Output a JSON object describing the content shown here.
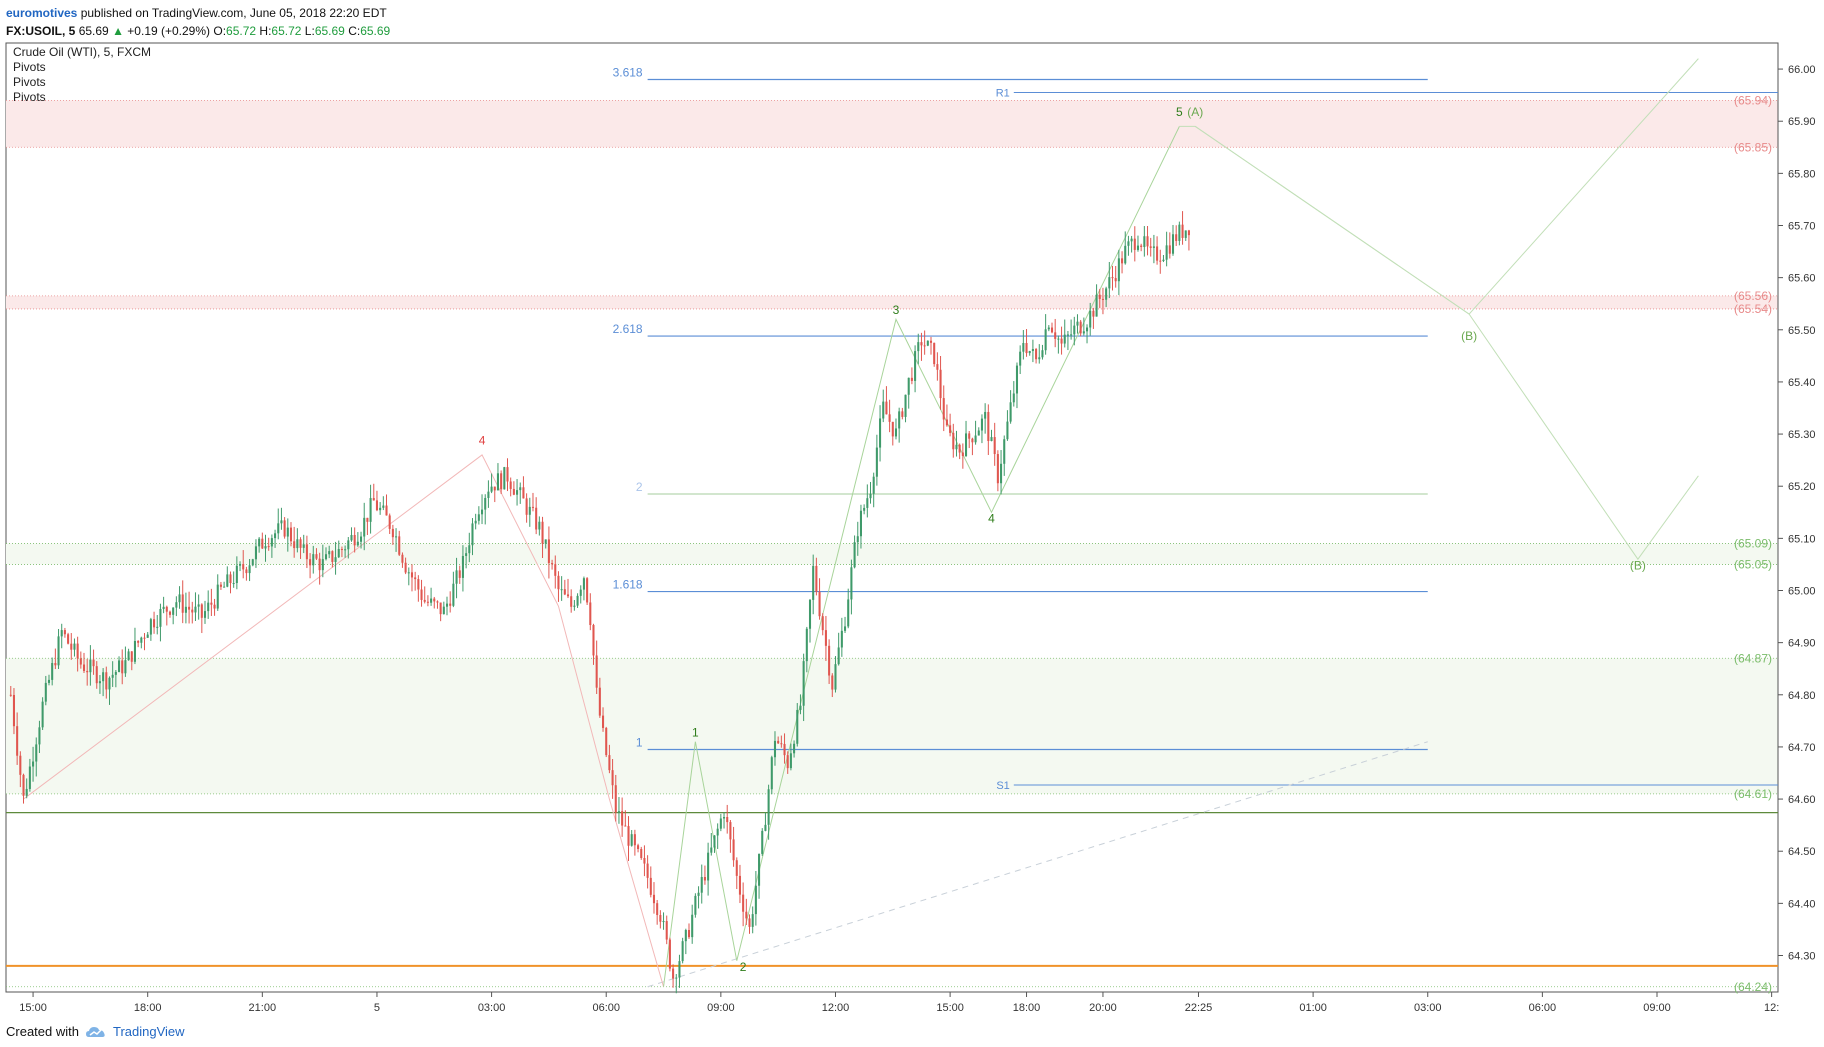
{
  "header": {
    "author": "euromotives",
    "published": "published on TradingView.com, June 05, 2018 22:20 EDT",
    "symbol": "FX:USOIL, 5",
    "last": "65.69",
    "change": "+0.19 (+0.29%)",
    "o_label": "O:",
    "o_value": "65.72",
    "h_label": "H:",
    "h_value": "65.72",
    "l_label": "L:",
    "l_value": "65.69",
    "c_label": "C:",
    "c_value": "65.69"
  },
  "legend": {
    "title": "Crude Oil (WTI), 5, FXCM",
    "indicators": [
      "Pivots",
      "Pivots",
      "Pivots"
    ]
  },
  "footer": {
    "created_with": "Created with",
    "brand": "TradingView"
  },
  "colors": {
    "up": "#3f9a6a",
    "down": "#e0564f",
    "fib": "#5b8ed6",
    "fibLight": "#aac4ea",
    "waveGreen": "#2e7d1a",
    "waveRed": "#e04040",
    "priceRed": "#e88b8b",
    "priceGreen": "#7cbd6c",
    "orange": "#f0922a",
    "axisText": "#333333"
  },
  "chart_data": {
    "type": "candlestick",
    "title": "Crude Oil (WTI), 5, FXCM",
    "ylim": [
      64.23,
      66.05
    ],
    "y_ticks": [
      "64.30",
      "64.40",
      "64.50",
      "64.60",
      "64.70",
      "64.80",
      "64.90",
      "65.00",
      "65.10",
      "65.20",
      "65.30",
      "65.40",
      "65.50",
      "65.60",
      "65.70",
      "65.80",
      "65.90",
      "66.00"
    ],
    "x_ticks": [
      {
        "i": 7,
        "label": "15:00"
      },
      {
        "i": 43,
        "label": "18:00"
      },
      {
        "i": 79,
        "label": "21:00"
      },
      {
        "i": 115,
        "label": "5"
      },
      {
        "i": 151,
        "label": "03:00"
      },
      {
        "i": 187,
        "label": "06:00"
      },
      {
        "i": 223,
        "label": "09:00"
      },
      {
        "i": 259,
        "label": "12:00"
      },
      {
        "i": 295,
        "label": "15:00"
      },
      {
        "i": 319,
        "label": "18:00"
      },
      {
        "i": 343,
        "label": "20:00"
      },
      {
        "i": 373,
        "label": "22:25"
      },
      {
        "i": 409,
        "label": "01:00"
      },
      {
        "i": 445,
        "label": "03:00"
      },
      {
        "i": 481,
        "label": "06:00"
      },
      {
        "i": 517,
        "label": "09:00"
      },
      {
        "i": 553,
        "label": "12:"
      }
    ],
    "x_range": [
      -1.5,
      555
    ],
    "candle_points": [
      [
        0,
        64.8
      ],
      [
        4,
        64.6
      ],
      [
        10,
        64.78
      ],
      [
        16,
        64.92
      ],
      [
        22,
        64.86
      ],
      [
        30,
        64.83
      ],
      [
        36,
        64.86
      ],
      [
        44,
        64.94
      ],
      [
        52,
        64.98
      ],
      [
        60,
        64.95
      ],
      [
        66,
        65.0
      ],
      [
        74,
        65.05
      ],
      [
        80,
        65.1
      ],
      [
        86,
        65.12
      ],
      [
        92,
        65.07
      ],
      [
        98,
        65.05
      ],
      [
        104,
        65.08
      ],
      [
        110,
        65.12
      ],
      [
        114,
        65.17
      ],
      [
        120,
        65.12
      ],
      [
        124,
        65.05
      ],
      [
        130,
        64.98
      ],
      [
        136,
        64.96
      ],
      [
        142,
        65.05
      ],
      [
        146,
        65.15
      ],
      [
        150,
        65.2
      ],
      [
        156,
        65.22
      ],
      [
        160,
        65.18
      ],
      [
        166,
        65.12
      ],
      [
        172,
        65.0
      ],
      [
        176,
        64.97
      ],
      [
        180,
        65.03
      ],
      [
        182,
        64.95
      ],
      [
        184,
        64.8
      ],
      [
        186,
        64.72
      ],
      [
        190,
        64.58
      ],
      [
        196,
        64.5
      ],
      [
        200,
        64.45
      ],
      [
        204,
        64.38
      ],
      [
        208,
        64.26
      ],
      [
        212,
        64.33
      ],
      [
        216,
        64.42
      ],
      [
        220,
        64.5
      ],
      [
        224,
        64.58
      ],
      [
        228,
        64.45
      ],
      [
        232,
        64.35
      ],
      [
        236,
        64.52
      ],
      [
        240,
        64.72
      ],
      [
        244,
        64.67
      ],
      [
        248,
        64.78
      ],
      [
        252,
        65.04
      ],
      [
        258,
        64.82
      ],
      [
        262,
        64.95
      ],
      [
        266,
        65.12
      ],
      [
        270,
        65.2
      ],
      [
        274,
        65.35
      ],
      [
        278,
        65.3
      ],
      [
        282,
        65.4
      ],
      [
        286,
        65.48
      ],
      [
        290,
        65.45
      ],
      [
        294,
        65.3
      ],
      [
        298,
        65.27
      ],
      [
        302,
        65.3
      ],
      [
        306,
        65.33
      ],
      [
        310,
        65.22
      ],
      [
        314,
        65.35
      ],
      [
        318,
        65.48
      ],
      [
        322,
        65.44
      ],
      [
        326,
        65.52
      ],
      [
        330,
        65.47
      ],
      [
        334,
        65.5
      ],
      [
        338,
        65.52
      ],
      [
        342,
        65.56
      ],
      [
        346,
        65.6
      ],
      [
        350,
        65.65
      ],
      [
        354,
        65.68
      ],
      [
        358,
        65.64
      ],
      [
        362,
        65.65
      ],
      [
        366,
        65.68
      ],
      [
        370,
        65.7
      ]
    ],
    "h_levels": [
      {
        "name": "support-line-dark-green",
        "value": 64.574,
        "color": "#5e8a3c",
        "width": 1.3,
        "from": -1.5,
        "to": 555
      },
      {
        "name": "support-line-orange",
        "value": 64.28,
        "color": "#f0922a",
        "width": 2,
        "from": -1.5,
        "to": 555
      }
    ],
    "fib_levels": [
      {
        "label": "3.618",
        "value": 65.98
      },
      {
        "label": "2.618",
        "value": 65.488
      },
      {
        "label": "2",
        "value": 65.185
      },
      {
        "label": "1.618",
        "value": 64.998
      },
      {
        "label": "1",
        "value": 64.695
      }
    ],
    "fib_x_range": [
      200,
      445
    ],
    "pivots": [
      {
        "label": "R1",
        "value": 65.955,
        "color": "#5b8ed6"
      },
      {
        "label": "S1",
        "value": 64.627,
        "color": "#5b8ed6"
      }
    ],
    "pivot_x_range": [
      315,
      555
    ],
    "price_labels": [
      {
        "text": "(65.94)",
        "value": 65.94,
        "color": "#e88b8b"
      },
      {
        "text": "(65.85)",
        "value": 65.85,
        "color": "#e88b8b"
      },
      {
        "text": "(65.56)",
        "value": 65.565,
        "color": "#e88b8b"
      },
      {
        "text": "(65.54)",
        "value": 65.54,
        "color": "#e88b8b"
      },
      {
        "text": "(65.09)",
        "value": 65.09,
        "color": "#7cbd6c"
      },
      {
        "text": "(65.05)",
        "value": 65.05,
        "color": "#7cbd6c"
      },
      {
        "text": "(64.87)",
        "value": 64.87,
        "color": "#7cbd6c"
      },
      {
        "text": "(64.61)",
        "value": 64.61,
        "color": "#7cbd6c"
      },
      {
        "text": "(64.24)",
        "value": 64.24,
        "color": "#7cbd6c"
      }
    ],
    "zones": [
      {
        "from": 65.85,
        "to": 65.94,
        "color": "#fbe9e9"
      },
      {
        "from": 65.54,
        "to": 65.565,
        "color": "#fbe9e9"
      },
      {
        "from": 64.61,
        "to": 64.87,
        "color": "#f4f9f1"
      },
      {
        "from": 65.05,
        "to": 65.09,
        "color": "#f4f9f1"
      }
    ],
    "wave_labels": [
      {
        "text": "4",
        "i": 148,
        "value": 65.28,
        "color": "#e04040"
      },
      {
        "text": "1",
        "i": 215,
        "value": 64.72,
        "color": "#2e7d1a"
      },
      {
        "text": "2",
        "i": 230,
        "value": 64.27,
        "color": "#2e7d1a"
      },
      {
        "text": "3",
        "i": 278,
        "value": 65.53,
        "color": "#2e7d1a"
      },
      {
        "text": "4",
        "i": 308,
        "value": 65.13,
        "color": "#2e7d1a"
      },
      {
        "text": "5",
        "i": 367,
        "value": 65.91,
        "color": "#2e7d1a"
      },
      {
        "text": "(A)",
        "i": 372,
        "value": 65.91,
        "color": "#6aa84f"
      },
      {
        "text": "(B)",
        "i": 458,
        "value": 65.48,
        "color": "#6aa84f"
      },
      {
        "text": "(B)",
        "i": 511,
        "value": 65.04,
        "color": "#6aa84f"
      }
    ],
    "wave_path_up": [
      [
        205,
        64.24
      ],
      [
        215,
        64.71
      ],
      [
        228,
        64.29
      ],
      [
        278,
        65.52
      ],
      [
        308,
        65.15
      ],
      [
        367,
        65.89
      ]
    ],
    "wave_path_down": [
      [
        4,
        64.6
      ],
      [
        148,
        65.26
      ],
      [
        172,
        64.97
      ],
      [
        188,
        64.6
      ],
      [
        205,
        64.24
      ]
    ],
    "projection_path": [
      [
        367,
        65.89
      ],
      [
        372,
        65.89
      ],
      [
        458,
        65.53
      ],
      [
        511,
        65.06
      ],
      [
        530,
        65.22
      ]
    ],
    "projection_path2": [
      [
        372,
        65.89
      ],
      [
        458,
        65.53
      ],
      [
        530,
        66.02
      ]
    ],
    "dashed_trend": [
      [
        200,
        64.24
      ],
      [
        445,
        64.71
      ]
    ]
  }
}
